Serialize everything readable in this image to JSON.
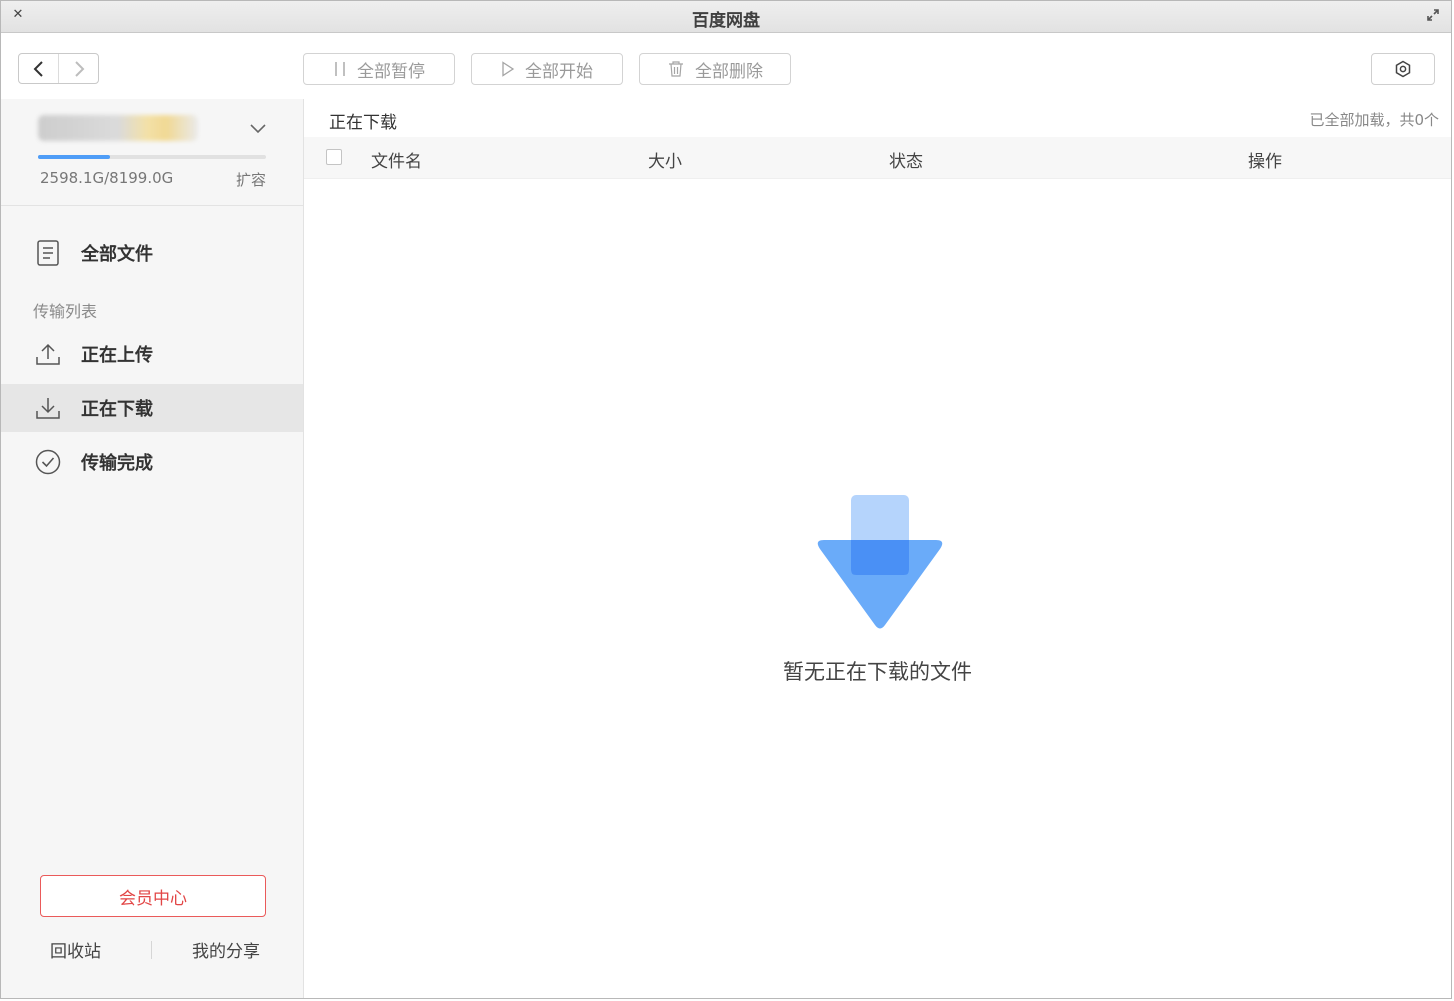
{
  "window": {
    "title": "百度网盘"
  },
  "toolbar": {
    "pause_all": "全部暂停",
    "start_all": "全部开始",
    "delete_all": "全部删除"
  },
  "account": {
    "quota_text": "2598.1G/8199.0G",
    "quota_used_fraction": 0.317,
    "expand_label": "扩容"
  },
  "sidebar": {
    "all_files": "全部文件",
    "section_label": "传输列表",
    "items": [
      {
        "label": "正在上传",
        "icon": "upload-icon"
      },
      {
        "label": "正在下载",
        "icon": "download-icon",
        "active": true
      },
      {
        "label": "传输完成",
        "icon": "check-circle-icon"
      }
    ],
    "vip_center": "会员中心",
    "recycle_bin": "回收站",
    "my_share": "我的分享"
  },
  "main": {
    "title": "正在下载",
    "status": "已全部加载，共0个",
    "columns": [
      "文件名",
      "大小",
      "状态",
      "操作"
    ],
    "empty_message": "暂无正在下载的文件"
  },
  "colors": {
    "accent_blue": "#4f9df7",
    "vip_red": "#e24646",
    "active_bg": "#e6e6e6"
  }
}
